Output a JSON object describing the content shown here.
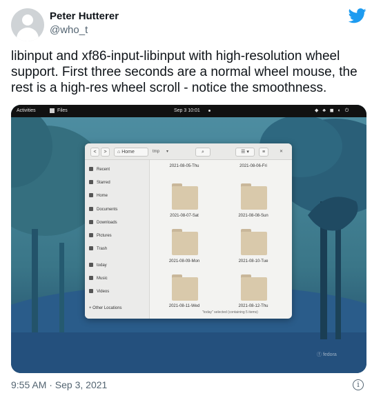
{
  "tweet": {
    "author_name": "Peter Hutterer",
    "author_handle": "@who_t",
    "text": "libinput and xf86-input-libinput with high-resolution wheel support. First three seconds are a normal wheel mouse, the rest is a high-res wheel scroll - notice the smoothness.",
    "timestamp": "9:55 AM · Sep 3, 2021",
    "info_icon": "info-icon",
    "brand_color": "#1d9bf0"
  },
  "video": {
    "topbar": {
      "activities": "Activities",
      "app_name": "Files",
      "clock": "Sep 3 10:01"
    },
    "file_manager": {
      "back_label": "<",
      "forward_label": ">",
      "path": [
        "Home",
        "tmp"
      ],
      "sidebar": [
        "Recent",
        "Starred",
        "Home",
        "Documents",
        "Downloads",
        "Pictures",
        "Trash",
        "today",
        "Music",
        "Videos",
        "+ Other Locations"
      ],
      "folders": [
        "2021-08-05-Thu",
        "2021-08-06-Fri",
        "2021-08-07-Sat",
        "2021-08-08-Sun",
        "2021-08-09-Mon",
        "2021-08-10-Tue",
        "2021-08-11-Wed",
        "2021-08-12-Thu"
      ],
      "status": "\"today\" selected (containing 5 items)"
    },
    "watermark": "fedora"
  }
}
